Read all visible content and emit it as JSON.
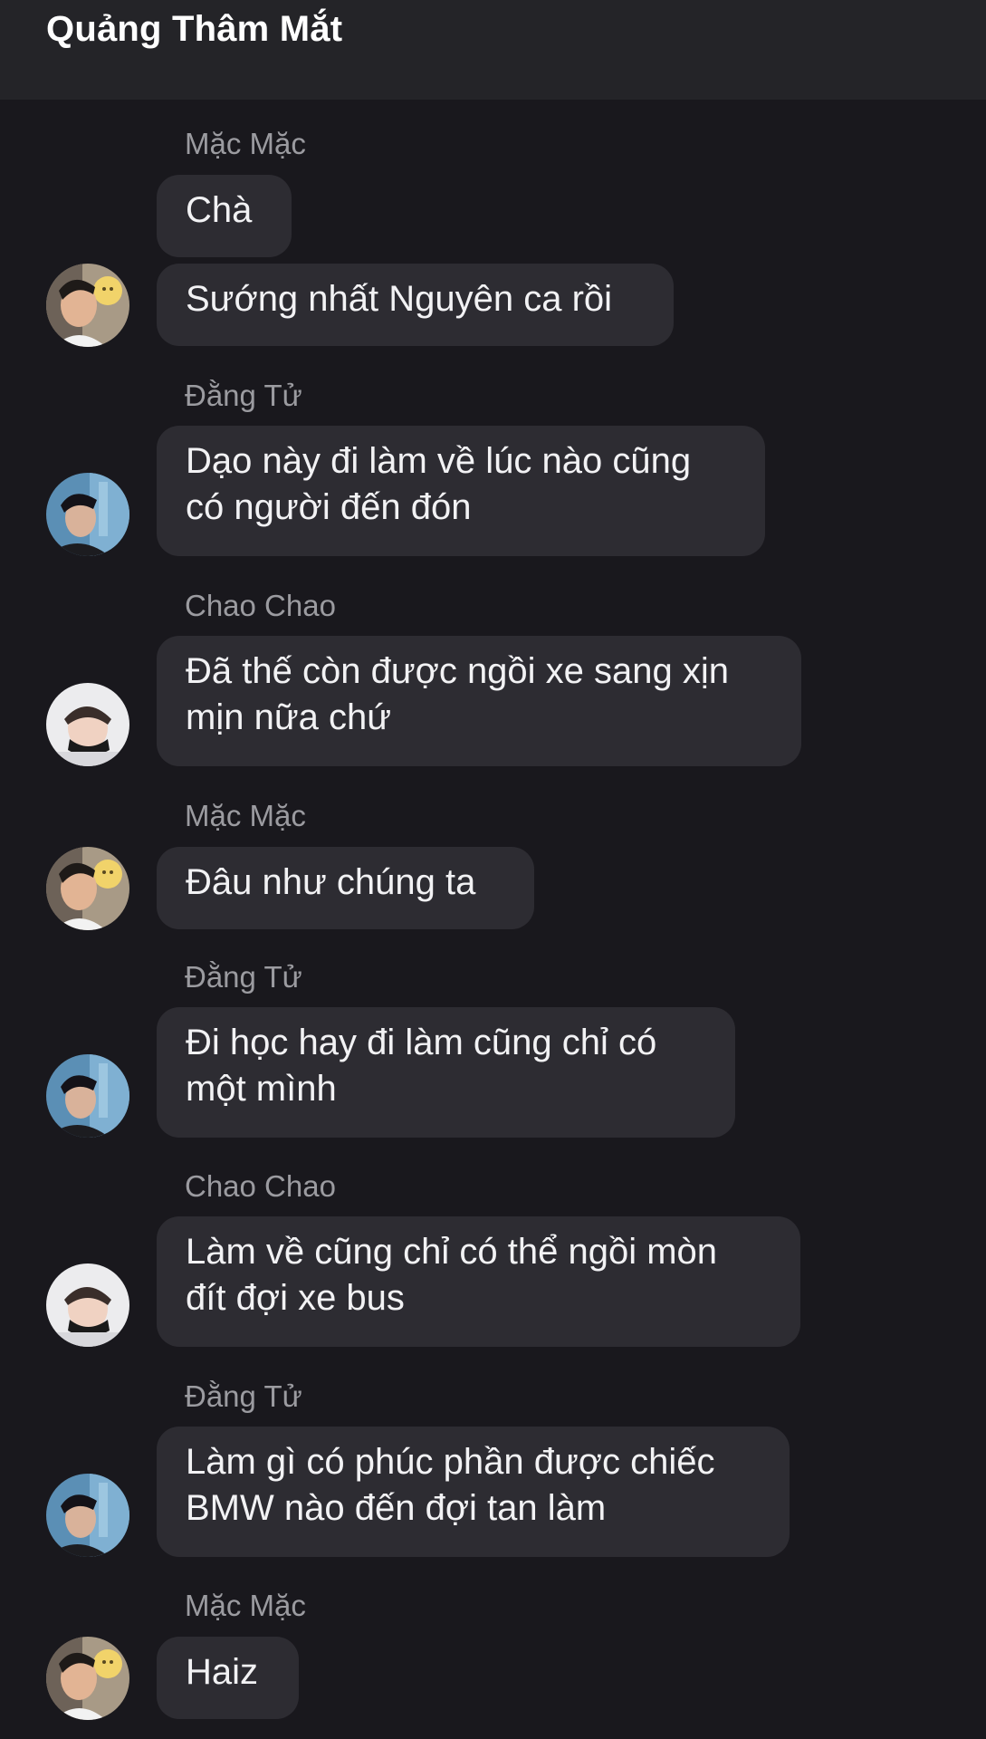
{
  "header": {
    "title": "Quảng Thâm Mắt"
  },
  "messages": [
    {
      "sender": "Mặc Mặc",
      "lines": [
        "Chà"
      ]
    },
    {
      "sender": "",
      "lines": [
        "Sướng nhất Nguyên ca rồi"
      ],
      "avatar": "avatar-mac-mac"
    },
    {
      "sender": "Đằng Tử",
      "lines": [
        "Dạo này đi làm về lúc nào cũng",
        "có người đến đón"
      ],
      "avatar": "avatar-dang-tu"
    },
    {
      "sender": "Chao Chao",
      "lines": [
        "Đã thế còn được ngồi xe sang xịn",
        "mịn nữa chứ"
      ],
      "avatar": "avatar-chao-chao"
    },
    {
      "sender": "Mặc Mặc",
      "lines": [
        "Đâu như chúng ta"
      ],
      "avatar": "avatar-mac-mac"
    },
    {
      "sender": "Đằng Tử",
      "lines": [
        "Đi học hay đi làm cũng chỉ có",
        "một mình"
      ],
      "avatar": "avatar-dang-tu"
    },
    {
      "sender": "Chao Chao",
      "lines": [
        "Làm về cũng chỉ có thể ngồi mòn",
        "đít đợi xe bus"
      ],
      "avatar": "avatar-chao-chao"
    },
    {
      "sender": "Đằng Tử",
      "lines": [
        "Làm gì có phúc phần được chiếc",
        "BMW nào đến đợi tan làm"
      ],
      "avatar": "avatar-dang-tu"
    },
    {
      "sender": "Mặc Mặc",
      "lines": [
        "Haiz"
      ],
      "avatar": "avatar-mac-mac"
    }
  ],
  "colors": {
    "background": "#19181d",
    "header": "#242428",
    "bubble": "#2d2c32",
    "sender_text": "#9b9ba0",
    "message_text": "#f2f2f4"
  }
}
